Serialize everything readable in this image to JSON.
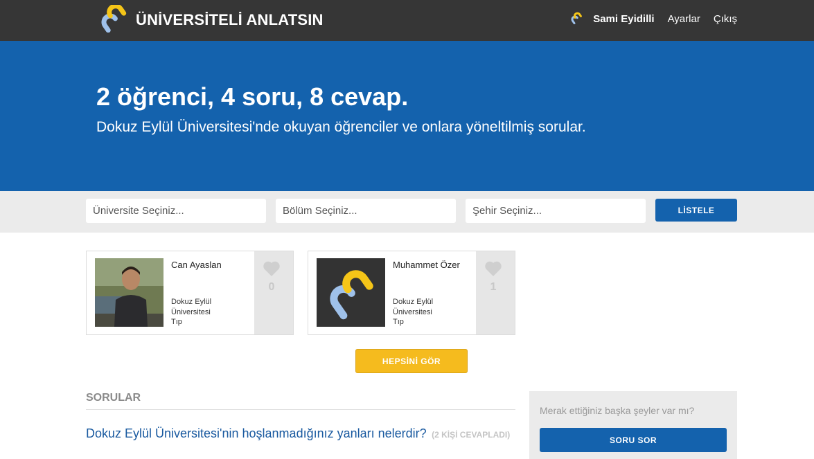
{
  "header": {
    "brand": "ÜNİVERSİTELİ ANLATSIN",
    "user_name": "Sami Eyidilli",
    "settings_label": "Ayarlar",
    "logout_label": "Çıkış"
  },
  "hero": {
    "title": "2 öğrenci, 4 soru, 8 cevap.",
    "subtitle": "Dokuz Eylül Üniversitesi'nde okuyan öğrenciler ve onlara yöneltilmiş sorular."
  },
  "filters": {
    "university_placeholder": "Üniversite Seçiniz...",
    "department_placeholder": "Bölüm Seçiniz...",
    "city_placeholder": "Şehir Seçiniz...",
    "list_button": "LİSTELE"
  },
  "students": [
    {
      "name": "Can Ayaslan",
      "university": "Dokuz Eylül Üniversitesi",
      "department": "Tıp",
      "likes": "0",
      "avatar": "photo"
    },
    {
      "name": "Muhammet Özer",
      "university": "Dokuz Eylül Üniversitesi",
      "department": "Tıp",
      "likes": "1",
      "avatar": "logo"
    }
  ],
  "see_all_button": "HEPSİNİ GÖR",
  "questions_section": {
    "title": "SORULAR",
    "items": [
      {
        "text": "Dokuz Eylül Üniversitesi'nin hoşlanmadığınız yanları nelerdir?",
        "meta": "(2 KİŞİ CEVAPLADI)"
      }
    ]
  },
  "ask_box": {
    "prompt": "Merak ettiğiniz başka şeyler var mı?",
    "button": "SORU SOR"
  },
  "colors": {
    "topbar": "#363636",
    "brand_blue": "#1462ad",
    "accent_yellow": "#f5bb1e",
    "logo_blue": "#9fc1ea"
  }
}
